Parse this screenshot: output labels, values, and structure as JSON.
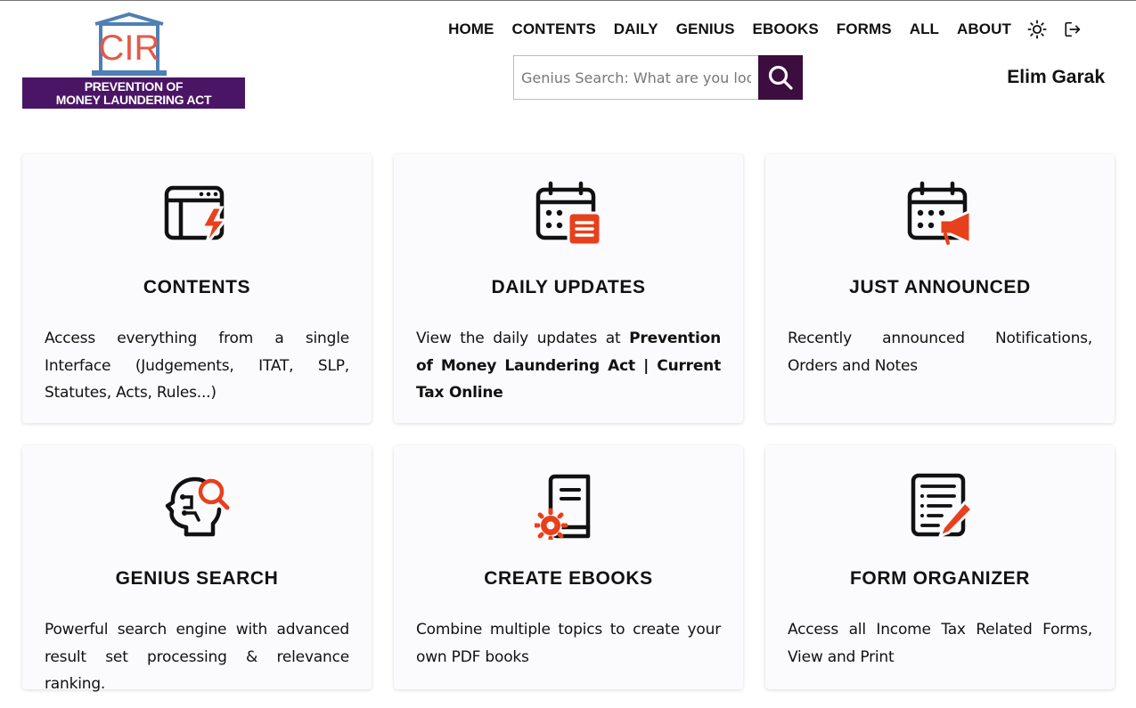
{
  "logo": {
    "emblem_text": "CIR",
    "banner_line1": "PREVENTION OF",
    "banner_line2": "MONEY LAUNDERING ACT"
  },
  "nav": {
    "items": [
      "HOME",
      "CONTENTS",
      "DAILY",
      "GENIUS",
      "EBOOKS",
      "FORMS",
      "ALL",
      "ABOUT"
    ],
    "theme_icon": "sun-icon",
    "logout_icon": "logout-icon"
  },
  "search": {
    "placeholder": "Genius Search: What are you looking for?",
    "button_icon": "search-icon"
  },
  "user": {
    "name": "Elim Garak"
  },
  "cards": [
    {
      "title": "CONTENTS",
      "icon": "browser-lightning-icon",
      "desc_plain": "Access everything from a single Interface (Judgements, ITAT, SLP, Statutes, Acts, Rules...)"
    },
    {
      "title": "DAILY UPDATES",
      "icon": "calendar-list-icon",
      "desc_plain": "View the daily updates at ",
      "desc_bold": "Prevention of Money Laundering Act | Current Tax Online"
    },
    {
      "title": "JUST ANNOUNCED",
      "icon": "calendar-megaphone-icon",
      "desc_plain": "Recently announced Notifications, Orders and Notes"
    },
    {
      "title": "GENIUS SEARCH",
      "icon": "brain-search-icon",
      "desc_plain": "Powerful search engine with advanced result set processing & relevance ranking."
    },
    {
      "title": "CREATE EBOOKS",
      "icon": "book-gear-icon",
      "desc_plain": "Combine multiple topics to create your own PDF books"
    },
    {
      "title": "FORM ORGANIZER",
      "icon": "form-pen-icon",
      "desc_plain": "Access all Income Tax Related Forms, View and Print"
    }
  ],
  "colors": {
    "accent": "#e8401c",
    "brand_purple": "#4b1565",
    "search_button": "#3c0d3f",
    "emblem_blue": "#4f7fb4"
  }
}
